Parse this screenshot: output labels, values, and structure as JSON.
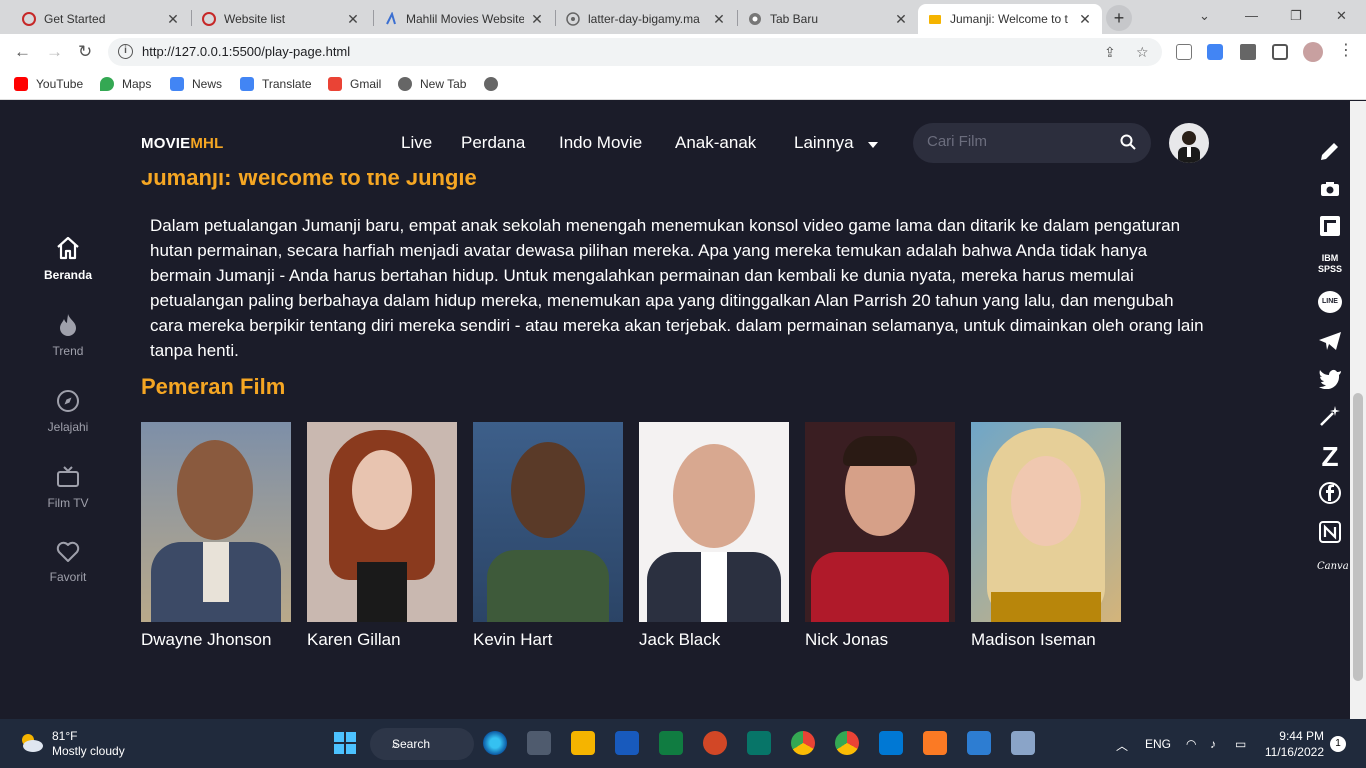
{
  "browser": {
    "tabs": [
      {
        "title": "Get Started"
      },
      {
        "title": "Website list"
      },
      {
        "title": "Mahlil Movies Website"
      },
      {
        "title": "latter-day-bigamy.ma"
      },
      {
        "title": "Tab Baru"
      },
      {
        "title": "Jumanji: Welcome to t"
      }
    ],
    "url": "http://127.0.0.1:5500/play-page.html",
    "bookmarks": [
      "YouTube",
      "Maps",
      "News",
      "Translate",
      "Gmail",
      "New Tab"
    ]
  },
  "site": {
    "logo_main": "MOVIE",
    "logo_accent": "MHL",
    "nav": [
      "Live",
      "Perdana",
      "Indo Movie",
      "Anak-anak",
      "Lainnya"
    ],
    "search_placeholder": "Cari Film",
    "sidebar": [
      {
        "label": "Beranda",
        "icon": "home-icon",
        "active": true
      },
      {
        "label": "Trend",
        "icon": "flame-icon",
        "active": false
      },
      {
        "label": "Jelajahi",
        "icon": "compass-icon",
        "active": false
      },
      {
        "label": "Film TV",
        "icon": "tv-icon",
        "active": false
      },
      {
        "label": "Favorit",
        "icon": "heart-icon",
        "active": false
      }
    ],
    "movie_title": "Jumanji: Welcome to the Jungle",
    "description": "Dalam petualangan Jumanji baru, empat anak sekolah menengah menemukan konsol video game lama dan ditarik ke dalam pengaturan hutan permainan, secara harfiah menjadi avatar dewasa pilihan mereka. Apa yang mereka temukan adalah bahwa Anda tidak hanya bermain Jumanji - Anda harus bertahan hidup. Untuk mengalahkan permainan dan kembali ke dunia nyata, mereka harus memulai petualangan paling berbahaya dalam hidup mereka, menemukan apa yang ditinggalkan Alan Parrish 20 tahun yang lalu, dan mengubah cara mereka berpikir tentang diri mereka sendiri - atau mereka akan terjebak. dalam permainan selamanya, untuk dimainkan oleh orang lain tanpa henti.",
    "cast_heading": "Pemeran Film",
    "cast": [
      {
        "name": "Dwayne Jhonson"
      },
      {
        "name": "Karen Gillan"
      },
      {
        "name": "Kevin Hart"
      },
      {
        "name": "Jack Black"
      },
      {
        "name": "Nick Jonas"
      },
      {
        "name": "Madison Iseman"
      }
    ],
    "accent_color": "#f5a623"
  },
  "dock": {
    "ibm_label_1": "IBM",
    "ibm_label_2": "SPSS",
    "line_label": "LINE",
    "canva_label": "Canva"
  },
  "taskbar": {
    "temperature": "81°F",
    "weather": "Mostly cloudy",
    "search_label": "Search",
    "language": "ENG",
    "time": "9:44 PM",
    "date": "11/16/2022",
    "notifications": "1"
  }
}
